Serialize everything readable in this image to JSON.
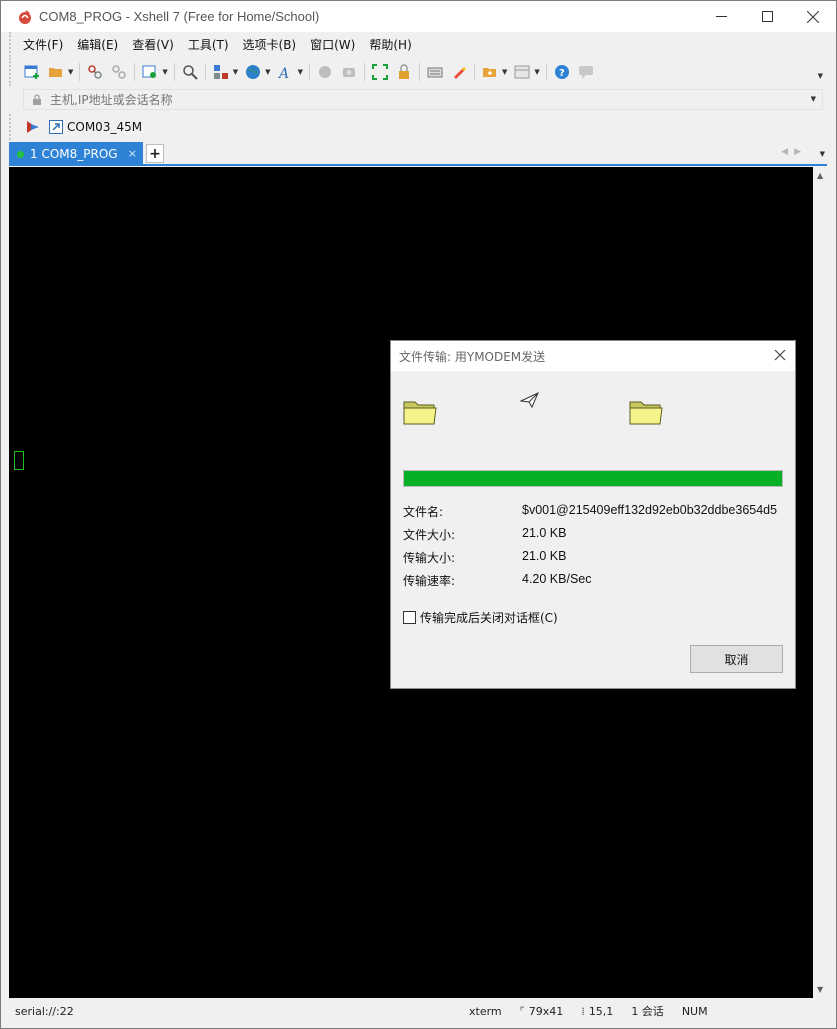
{
  "window": {
    "title": "COM8_PROG - Xshell 7 (Free for Home/School)"
  },
  "menu": [
    {
      "label": "文件(F)"
    },
    {
      "label": "编辑(E)"
    },
    {
      "label": "查看(V)"
    },
    {
      "label": "工具(T)"
    },
    {
      "label": "选项卡(B)"
    },
    {
      "label": "窗口(W)"
    },
    {
      "label": "帮助(H)"
    }
  ],
  "address": {
    "placeholder": "主机,IP地址或会话名称"
  },
  "links": {
    "session_label": "COM03_45M"
  },
  "tabs": [
    {
      "label": "1 COM8_PROG",
      "close": "×"
    }
  ],
  "tab_add_label": "+",
  "dialog": {
    "title": "文件传输: 用YMODEM发送",
    "progress_fraction": 1.0,
    "rows": [
      {
        "label": "文件名:",
        "value": "$v001@215409eff132d92eb0b32ddbe3654d5"
      },
      {
        "label": "文件大小:",
        "value": "21.0 KB"
      },
      {
        "label": "传输大小:",
        "value": "21.0 KB"
      },
      {
        "label": "传输速率:",
        "value": "4.20 KB/Sec"
      }
    ],
    "checkbox_label": "传输完成后关闭对话框(C)",
    "checkbox_checked": false,
    "cancel_label": "取消"
  },
  "status": {
    "connection": "serial://:22",
    "term_type": "xterm",
    "size": "79x41",
    "cursor_pos": "15,1",
    "sessions": "1 会话",
    "num": "NUM"
  },
  "colors": {
    "accent": "#2e83d6",
    "progress": "#06b025",
    "terminal_bg": "#000000",
    "cursor": "#20c020"
  }
}
